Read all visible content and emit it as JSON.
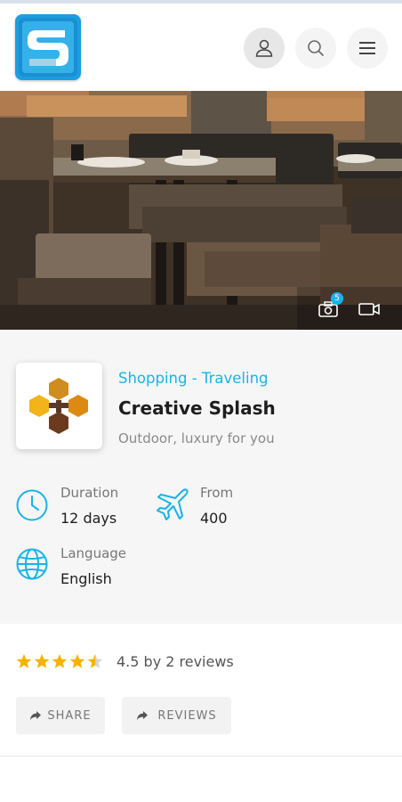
{
  "header": {
    "logo_icon": "splash-s-logo-icon",
    "buttons": [
      "user-icon",
      "search-icon",
      "menu-icon"
    ]
  },
  "hero": {
    "image": "restaurant-booth-photo",
    "photo_count": "5",
    "photo_icon": "camera-icon",
    "video_icon": "video-icon"
  },
  "listing": {
    "category": "Shopping - Traveling",
    "title": "Creative Splash",
    "subtitle": "Outdoor, luxury for you",
    "meta": {
      "duration_label": "Duration",
      "duration_value": "12 days",
      "from_label": "From",
      "from_value": "400",
      "language_label": "Language",
      "language_value": "English"
    }
  },
  "rating": {
    "score": 4.5,
    "max": 5,
    "text": "4.5 by 2 reviews"
  },
  "actions": {
    "share_label": "SHARE",
    "reviews_label": "REVIEWS"
  },
  "colors": {
    "accent": "#18b4e6",
    "star": "#f5b301",
    "logo_blue": "#1a9fe0",
    "hex_gold": "#e2a21b",
    "hex_dark": "#6b3a1f"
  }
}
